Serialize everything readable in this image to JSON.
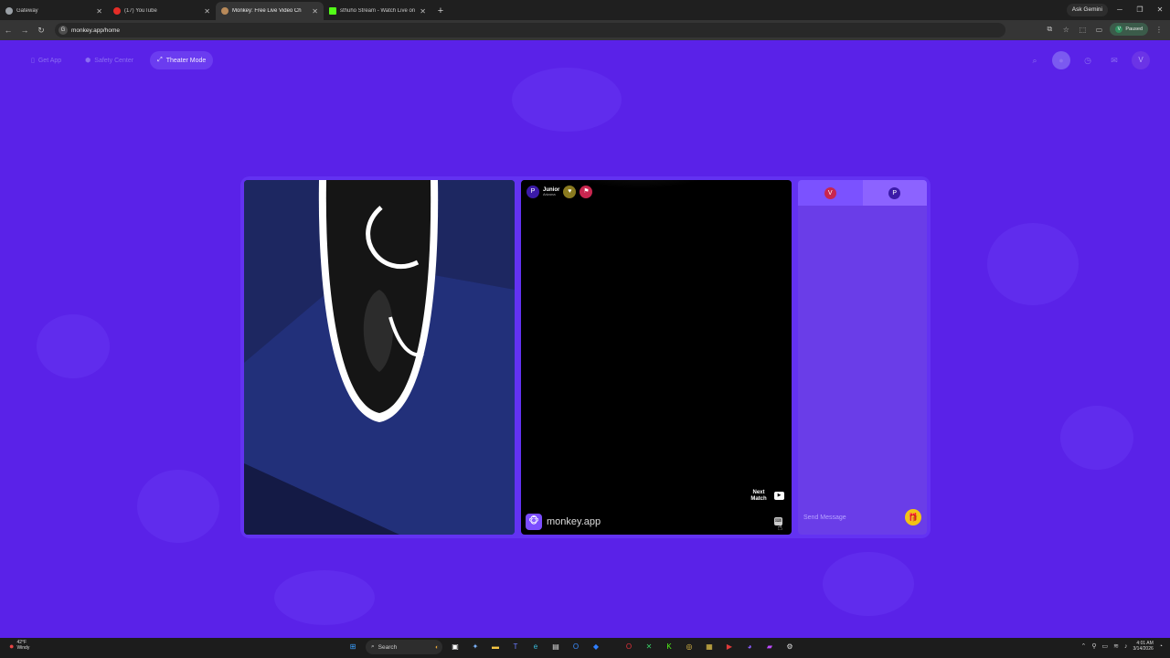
{
  "browser": {
    "tabs": [
      {
        "title": "Gateway",
        "color": "#9aa0a6",
        "active": false
      },
      {
        "title": "(17) YouTube",
        "color": "#e52d27",
        "active": false
      },
      {
        "title": "Monkey: Free Live Video Ch",
        "color": "#b98a5a",
        "active": true
      },
      {
        "title": "sthuho Stream - Watch Live on",
        "color": "#53fc18",
        "active": false
      }
    ],
    "new_tab": "+",
    "ask_gemini": "Ask Gemini",
    "url": "monkey.app/home",
    "profile_status": "Paused",
    "profile_initial": "V"
  },
  "nav": {
    "get_app": "Get App",
    "safety_center": "Safety Center",
    "theater_mode": "Theater Mode",
    "profile_initial": "V"
  },
  "match": {
    "partner_initial": "P",
    "partner_name": "Junior",
    "partner_location": "Arizona",
    "next_label_1": "Next",
    "next_label_2": "Match",
    "brand": "monkey.app"
  },
  "chat": {
    "user_a_initial": "V",
    "user_b_initial": "P",
    "placeholder": "Send Message"
  },
  "taskbar": {
    "temp": "42°F",
    "weather": "Windy",
    "search": "Search",
    "time": "4:01 AM",
    "date": "3/14/2026"
  }
}
